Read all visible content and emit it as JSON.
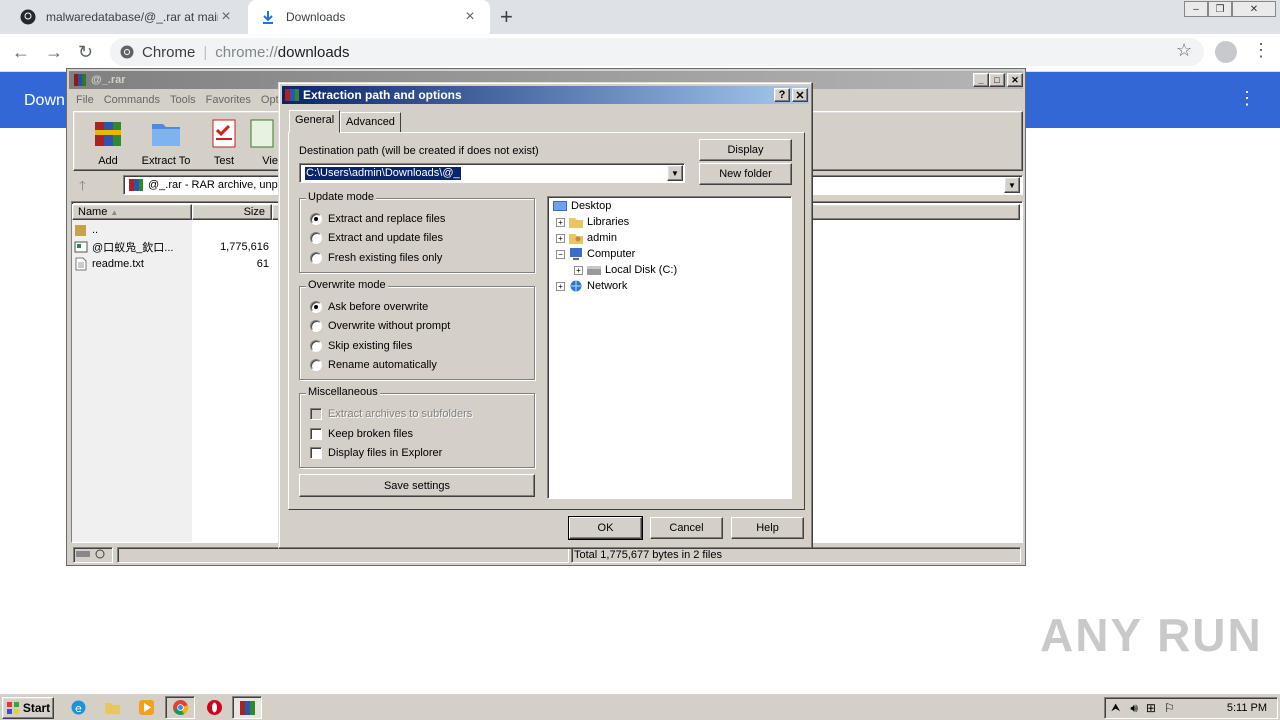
{
  "browser": {
    "tabs": [
      {
        "title": "malwaredatabase/@_.rar at main · p",
        "icon": "github-icon"
      },
      {
        "title": "Downloads",
        "icon": "download-icon"
      }
    ],
    "omnibox": {
      "site": "Chrome",
      "scheme": "chrome://",
      "path": "downloads"
    },
    "page_title": "Down"
  },
  "winrar": {
    "title": "@_.rar",
    "menu": [
      "File",
      "Commands",
      "Tools",
      "Favorites",
      "Opt"
    ],
    "toolbar": [
      {
        "label": "Add",
        "icon": "add-archive-icon"
      },
      {
        "label": "Extract To",
        "icon": "extract-folder-icon"
      },
      {
        "label": "Test",
        "icon": "test-icon"
      },
      {
        "label": "Vie",
        "icon": "view-icon"
      }
    ],
    "address": "@_.rar - RAR archive, unpa",
    "columns": {
      "name": "Name",
      "size": "Size"
    },
    "files": [
      {
        "name": "..",
        "size": "",
        "icon": "folder-up-icon"
      },
      {
        "name": "@口蚁凫_欽口...",
        "size": "1,775,616",
        "icon": "exe-file-icon"
      },
      {
        "name": "readme.txt",
        "size": "61",
        "icon": "text-file-icon"
      }
    ],
    "status": "Total 1,775,677 bytes in 2 files"
  },
  "dialog": {
    "title": "Extraction path and options",
    "tabs": [
      "General",
      "Advanced"
    ],
    "dest_label": "Destination path (will be created if does not exist)",
    "dest_value": "C:\\Users\\admin\\Downloads\\@_",
    "display_btn": "Display",
    "new_folder_btn": "New folder",
    "update_mode": {
      "label": "Update mode",
      "options": [
        "Extract and replace files",
        "Extract and update files",
        "Fresh existing files only"
      ],
      "selected": 0
    },
    "overwrite_mode": {
      "label": "Overwrite mode",
      "options": [
        "Ask before overwrite",
        "Overwrite without prompt",
        "Skip existing files",
        "Rename automatically"
      ],
      "selected": 0
    },
    "misc": {
      "label": "Miscellaneous",
      "options": [
        "Extract archives to subfolders",
        "Keep broken files",
        "Display files in Explorer"
      ]
    },
    "save_btn": "Save settings",
    "tree": [
      "Desktop",
      "Libraries",
      "admin",
      "Computer",
      "Local Disk (C:)",
      "Network"
    ],
    "ok": "OK",
    "cancel": "Cancel",
    "help": "Help"
  },
  "taskbar": {
    "start": "Start",
    "clock": "5:11 PM"
  },
  "watermark": "ANY RUN"
}
